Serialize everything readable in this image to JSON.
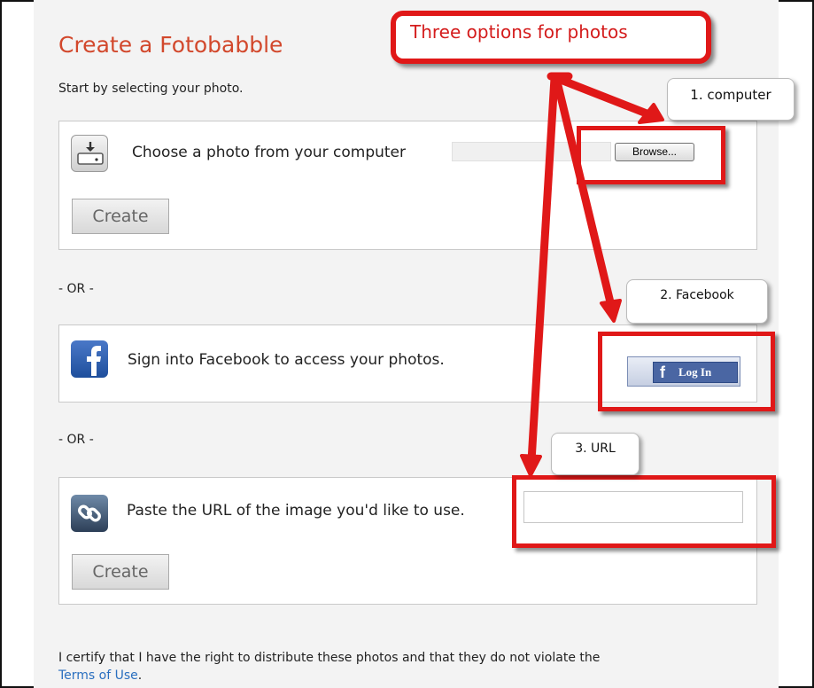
{
  "page": {
    "title": "Create a Fotobabble",
    "subtitle": "Start by selecting your photo.",
    "or_divider": "- OR -"
  },
  "options": {
    "computer": {
      "label": "Choose a photo from your computer",
      "browse_label": "Browse...",
      "create_label": "Create",
      "icon": "upload-icon"
    },
    "facebook": {
      "label": "Sign into Facebook to access your photos.",
      "login_icon_glyph": "f",
      "login_label": "Log In",
      "icon": "facebook-icon"
    },
    "url": {
      "label": "Paste the URL of the image you'd like to use.",
      "input_value": "",
      "create_label": "Create",
      "icon": "link-icon"
    }
  },
  "certify": {
    "text": "I certify that I have the right to distribute these photos and that they do not violate the",
    "link_text": "Terms of Use",
    "suffix": "."
  },
  "annotations": {
    "headline": "Three options for photos",
    "tag_computer": "1. computer",
    "tag_facebook": "2. Facebook",
    "tag_url": "3. URL",
    "color": "#e01818"
  }
}
